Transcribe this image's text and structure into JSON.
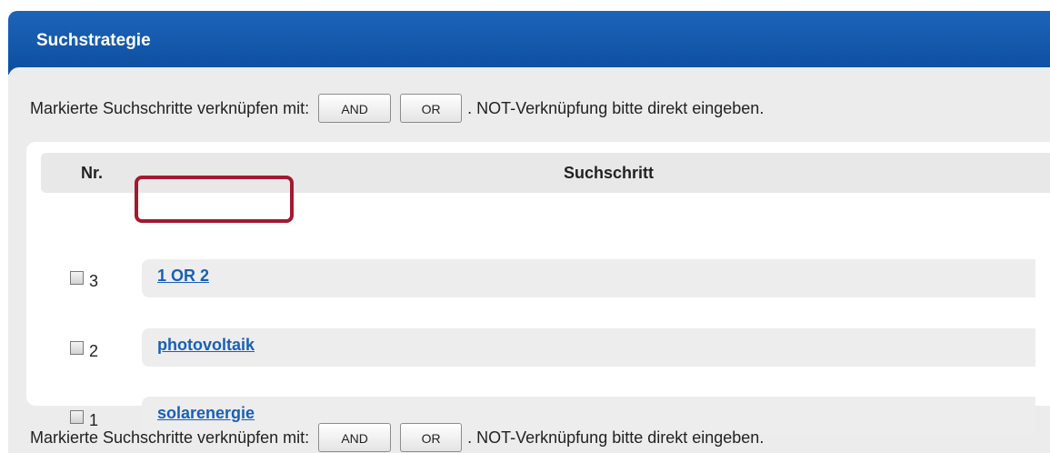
{
  "panel": {
    "title": "Suchstrategie"
  },
  "actions": {
    "prefix": "Markierte Suchschritte verknüpfen mit:",
    "and_label": "AND",
    "or_label": "OR",
    "suffix": ". NOT-Verknüpfung bitte direkt eingeben."
  },
  "table": {
    "col_nr": "Nr.",
    "col_step": "Suchschritt",
    "rows": [
      {
        "nr": "3",
        "query": "1 OR 2",
        "checked": false
      },
      {
        "nr": "2",
        "query": "photovoltaik",
        "checked": false,
        "highlighted": true
      },
      {
        "nr": "1",
        "query": "solarenergie",
        "checked": false
      }
    ]
  },
  "colors": {
    "header_blue": "#0c4e9f",
    "link_blue": "#1760b8",
    "highlight_red": "#a11a2e",
    "panel_gray": "#ececec"
  },
  "icons": {
    "row_checkbox": "checkbox-icon"
  }
}
